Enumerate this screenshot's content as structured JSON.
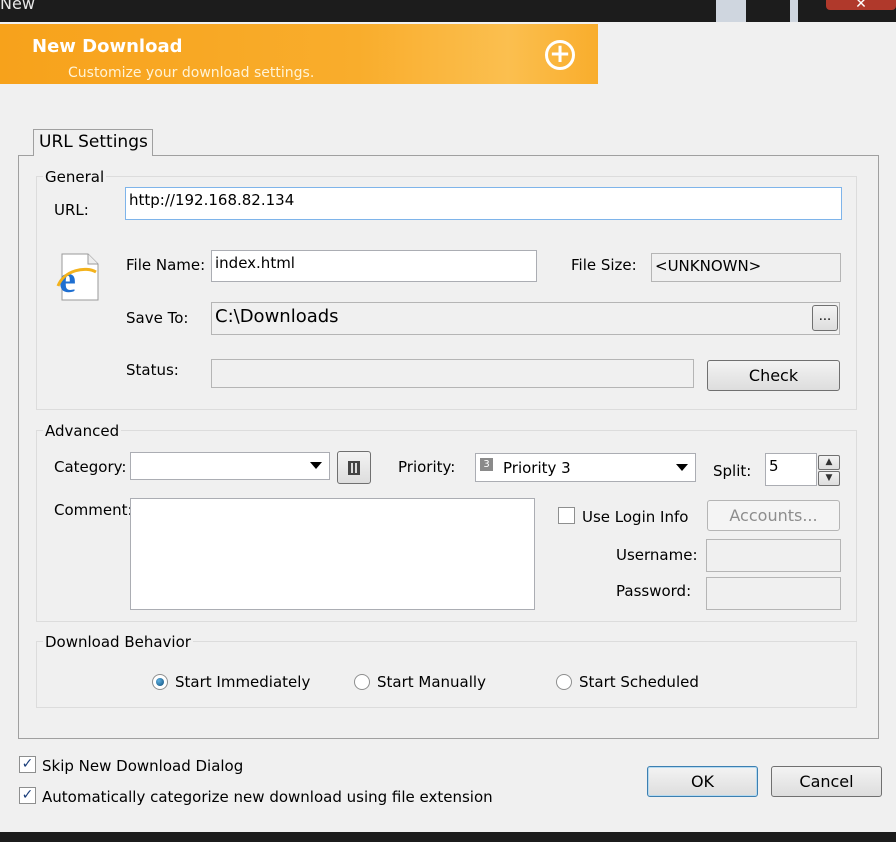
{
  "window": {
    "title": "New"
  },
  "banner": {
    "title": "New Download",
    "subtitle": "Customize your download settings."
  },
  "tab": {
    "label": "URL Settings"
  },
  "general": {
    "legend": "General",
    "url_label": "URL:",
    "url_value": "http://192.168.82.134",
    "filename_label": "File Name:",
    "filename_value": "index.html",
    "filesize_label": "File Size:",
    "filesize_value": "<UNKNOWN>",
    "saveto_label": "Save To:",
    "saveto_value": "C:\\Downloads",
    "browse_label": "...",
    "status_label": "Status:",
    "status_value": "",
    "check_label": "Check"
  },
  "advanced": {
    "legend": "Advanced",
    "category_label": "Category:",
    "category_value": "",
    "priority_label": "Priority:",
    "priority_badge": "3",
    "priority_value": "Priority 3",
    "split_label": "Split:",
    "split_value": "5",
    "comment_label": "Comment:",
    "use_login_label": "Use Login Info",
    "accounts_label": "Accounts...",
    "username_label": "Username:",
    "password_label": "Password:"
  },
  "behavior": {
    "legend": "Download Behavior",
    "options": [
      "Start Immediately",
      "Start Manually",
      "Start Scheduled"
    ],
    "selected": "Start Immediately"
  },
  "footer": {
    "skip_dialog_label": "Skip New Download Dialog",
    "auto_categorize_label": "Automatically categorize new download using file extension",
    "ok_label": "OK",
    "cancel_label": "Cancel"
  },
  "colors": {
    "banner": "#f7a21b",
    "accent_blue": "#3c7fb1"
  },
  "icons": [
    "close-icon",
    "add-circle-icon",
    "ie-file-icon",
    "bookmark-icon",
    "dropdown-caret-icon",
    "spin-up-icon",
    "spin-down-icon"
  ]
}
